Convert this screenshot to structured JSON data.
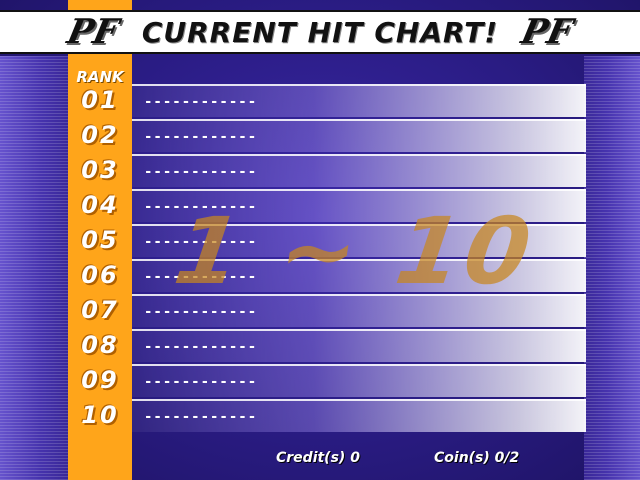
{
  "header": {
    "title": "CURRENT HIT CHART!",
    "logo_left": "PF",
    "logo_right": "PF"
  },
  "rank_header": "RANK",
  "range_label": "1 ~ 10",
  "rows": [
    {
      "rank": "01",
      "title": "------------"
    },
    {
      "rank": "02",
      "title": "------------"
    },
    {
      "rank": "03",
      "title": "------------"
    },
    {
      "rank": "04",
      "title": "------------"
    },
    {
      "rank": "05",
      "title": "------------"
    },
    {
      "rank": "06",
      "title": "------------"
    },
    {
      "rank": "07",
      "title": "------------"
    },
    {
      "rank": "08",
      "title": "------------"
    },
    {
      "rank": "09",
      "title": "------------"
    },
    {
      "rank": "10",
      "title": "------------"
    }
  ],
  "footer": {
    "credits": "Credit(s) 0",
    "coins": "Coin(s) 0/2"
  },
  "colors": {
    "background": "#2a1a7a",
    "rank_column": "#ffa51a",
    "range_overlay": "#c8871e"
  }
}
